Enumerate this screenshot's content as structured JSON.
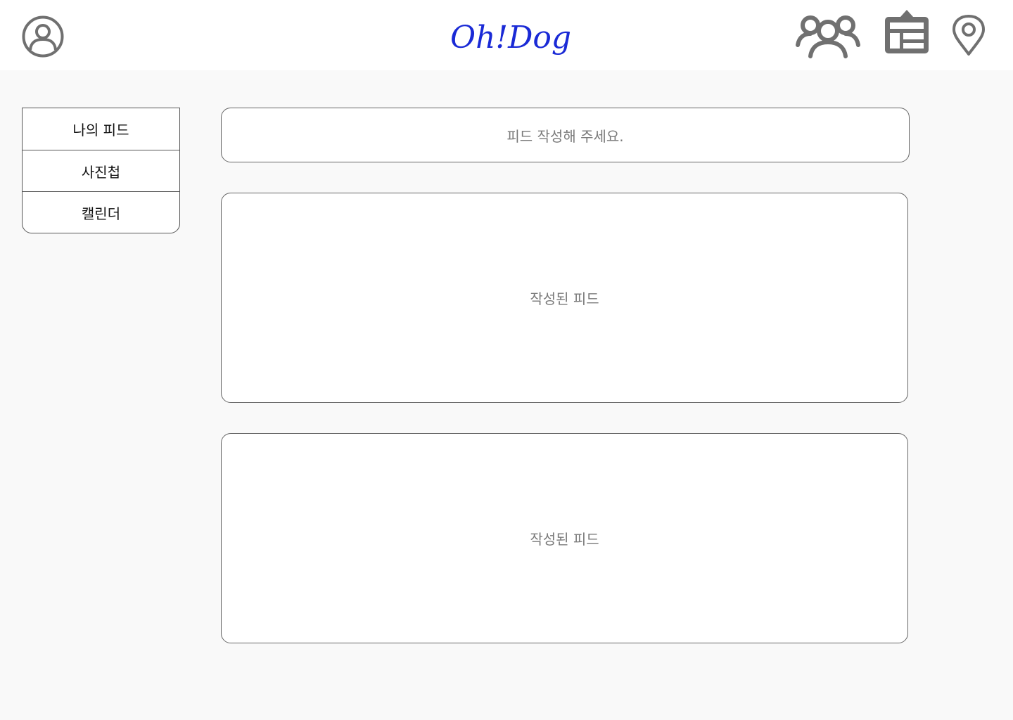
{
  "header": {
    "logo_text": "Oh!Dog",
    "logo_color": "#1a2ad6",
    "icons": {
      "profile": "user-circle-icon",
      "friends": "group-icon",
      "board": "board-icon",
      "map": "map-pin-icon"
    },
    "icon_color": "#707070"
  },
  "sidebar": {
    "items": [
      {
        "label": "나의 피드"
      },
      {
        "label": "사진첩"
      },
      {
        "label": "캘린더"
      }
    ]
  },
  "main": {
    "write_placeholder": "피드 작성해 주세요.",
    "feeds": [
      {
        "text": "작성된 피드"
      },
      {
        "text": "작성된 피드"
      }
    ]
  }
}
